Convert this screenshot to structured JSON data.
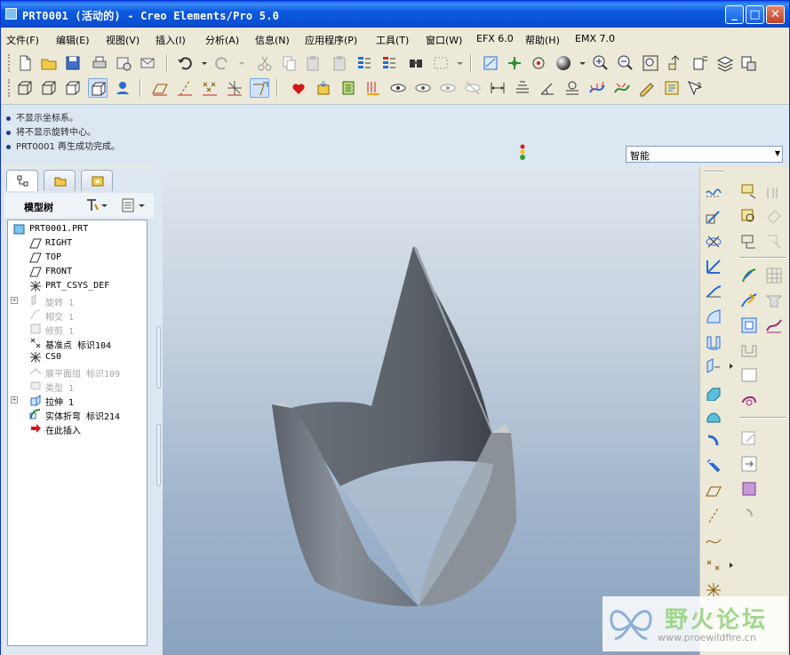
{
  "window": {
    "title": "PRT0001 (活动的) - Creo Elements/Pro 5.0",
    "minimize_label": "_",
    "maximize_label": "□",
    "close_label": "✕"
  },
  "menu": [
    "文件(F)",
    "编辑(E)",
    "视图(V)",
    "插入(I)",
    "分析(A)",
    "信息(N)",
    "应用程序(P)",
    "工具(T)",
    "窗口(W)",
    "EFX 6.0",
    "帮助(H)",
    "EMX 7.0"
  ],
  "messages": [
    "不显示坐标系。",
    "将不显示旋转中心。",
    "PRT0001 再生成功完成。"
  ],
  "filter": {
    "selected": "智能"
  },
  "tree": {
    "title": "模型树",
    "items": [
      {
        "label": "PRT0001.PRT",
        "icon": "part-icon",
        "dim": false,
        "expander": false
      },
      {
        "label": "RIGHT",
        "icon": "datum-plane-icon",
        "dim": false,
        "expander": false
      },
      {
        "label": "TOP",
        "icon": "datum-plane-icon",
        "dim": false,
        "expander": false
      },
      {
        "label": "FRONT",
        "icon": "datum-plane-icon",
        "dim": false,
        "expander": false
      },
      {
        "label": "PRT_CSYS_DEF",
        "icon": "csys-icon",
        "dim": false,
        "expander": false
      },
      {
        "label": "旋转 1",
        "icon": "revolve-icon",
        "dim": true,
        "expander": true
      },
      {
        "label": "相交 1",
        "icon": "intersect-icon",
        "dim": true,
        "expander": false
      },
      {
        "label": "修剪 1",
        "icon": "trim-icon",
        "dim": true,
        "expander": false
      },
      {
        "label": "基准点 标识104",
        "icon": "datum-point-icon",
        "dim": false,
        "expander": false
      },
      {
        "label": "CS0",
        "icon": "csys-icon",
        "dim": false,
        "expander": false
      },
      {
        "label": "展平面组 标识109",
        "icon": "flatten-quilt-icon",
        "dim": true,
        "expander": false
      },
      {
        "label": "类型 1",
        "icon": "type-icon",
        "dim": true,
        "expander": false
      },
      {
        "label": "拉伸 1",
        "icon": "extrude-icon",
        "dim": false,
        "expander": true
      },
      {
        "label": "实体折弯 标识214",
        "icon": "toroidal-bend-icon",
        "dim": false,
        "expander": false
      },
      {
        "label": "在此插入",
        "icon": "insert-here-icon",
        "dim": false,
        "expander": false
      }
    ]
  },
  "watermark": {
    "text": "野火论坛",
    "url": "www.proewildfire.cn"
  }
}
